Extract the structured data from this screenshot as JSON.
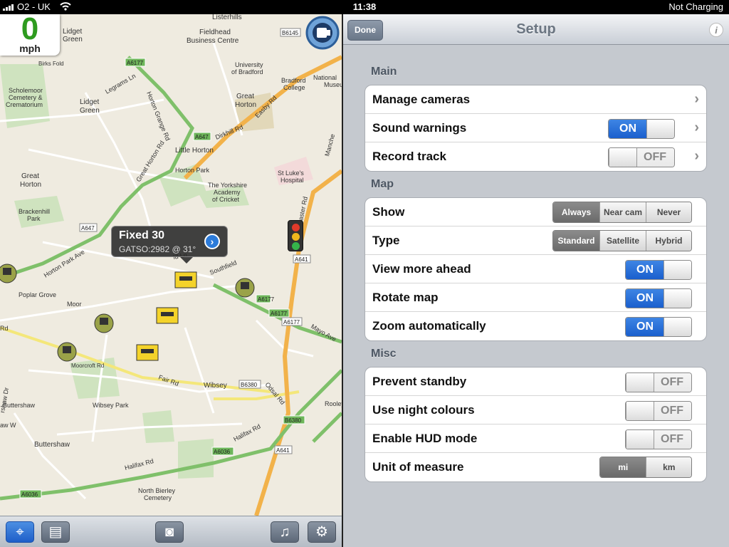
{
  "status_bar": {
    "carrier": "O2 - UK",
    "time": "11:38",
    "battery": "Not Charging"
  },
  "speed": {
    "value": "0",
    "unit": "mph"
  },
  "callout": {
    "title": "Fixed 30",
    "subtitle": "GATSO:2982 @ 31°"
  },
  "map_labels": {
    "lidget_green_1": "Lidget",
    "lidget_green_2": "Green",
    "fieldhead": "Fieldhead",
    "business_centre": "Business Centre",
    "listerhills": "Listerhills",
    "uni1": "University",
    "uni2": "of Bradford",
    "bradford_college1": "Bradford",
    "bradford_college2": "College",
    "national": "National",
    "museum": "Museu",
    "scholemoor1": "Scholemoor",
    "scholemoor2": "Cemetery &",
    "scholemoor3": "Crematorium",
    "lidget2_1": "Lidget",
    "lidget2_2": "Green",
    "great_horton1": "Great",
    "great_horton2": "Horton",
    "great_horton_b1": "Great",
    "great_horton_b2": "Horton",
    "little_horton": "Little Horton",
    "horton_park": "Horton Park",
    "yorkshire1": "The Yorkshire",
    "yorkshire2": "Academy",
    "yorkshire3": "of Cricket",
    "st_lukes1": "St Luke's",
    "st_lukes2": "Hospital",
    "brackenhill1": "Brackenhill",
    "brackenhill2": "Park",
    "poplar_grove": "Poplar Grove",
    "wibsey": "Wibsey",
    "wibsey_park": "Wibsey Park",
    "buttershaw": "Buttershaw",
    "buttershaw2": "Buttershaw",
    "north_bierley1": "North Bierley",
    "north_bierley2": "Cemetery",
    "horton_grange_rd": "Horton Grange Rd",
    "great_horton_rd": "Great Horton Rd",
    "horton_park_ave": "Horton Park Ave",
    "easby_rd": "Easby Rd",
    "dirkhill_rd": "Dirkhill Rd",
    "legrams_ln": "Legrams Ln",
    "southfield": "Southfield",
    "mayo_ave": "Mayo Ave",
    "fair_rd": "Fair Rd",
    "odsal_rd": "Odsal Rd",
    "halifax_rd": "Halifax Rd",
    "halifax_rd2": "Halifax Rd",
    "rooley": "Rooley",
    "moor": "Moor",
    "birks_fold": "Birks Fold",
    "mancross": "Manche",
    "a6177": "A6177",
    "a647": "A647",
    "a647b": "A647",
    "a641": "A641",
    "a641b": "A641",
    "a6177b": "A6177",
    "a6177c": "A6177",
    "b6145": "B6145",
    "b6380": "B6380",
    "b6380b": "B6380",
    "a6036": "A6036",
    "a6036b": "A6036",
    "a641c": "A641",
    "a6177d": "A6177",
    "aster_rd": "aster Rd",
    "fold1": "Birks Fold",
    "moorcroft": "Moorcroft Rd",
    "ldd_ln": "ld Ln",
    "road_rd": "Rd",
    "shaw_dr": "rshaw Dr",
    "aw_w": "aw W"
  },
  "toolbar": {
    "locate_icon": "crosshair-icon",
    "list_icon": "list-icon",
    "camera_icon": "camera-icon",
    "music_icon": "music-icon",
    "settings_icon": "gear-icon"
  },
  "nav": {
    "done": "Done",
    "title": "Setup",
    "info": "i"
  },
  "sections": {
    "main": {
      "header": "Main",
      "rows": [
        {
          "label": "Manage cameras"
        },
        {
          "label": "Sound warnings",
          "value": "ON"
        },
        {
          "label": "Record track",
          "value": "OFF"
        }
      ]
    },
    "map": {
      "header": "Map",
      "show": {
        "label": "Show",
        "options": [
          "Always",
          "Near cam",
          "Never"
        ],
        "selected": "Always"
      },
      "type": {
        "label": "Type",
        "options": [
          "Standard",
          "Satellite",
          "Hybrid"
        ],
        "selected": "Standard"
      },
      "toggles": [
        {
          "label": "View more ahead",
          "value": "ON"
        },
        {
          "label": "Rotate map",
          "value": "ON"
        },
        {
          "label": "Zoom automatically",
          "value": "ON"
        }
      ]
    },
    "misc": {
      "header": "Misc",
      "toggles": [
        {
          "label": "Prevent standby",
          "value": "OFF"
        },
        {
          "label": "Use night colours",
          "value": "OFF"
        },
        {
          "label": "Enable HUD mode",
          "value": "OFF"
        }
      ],
      "unit": {
        "label": "Unit of measure",
        "options": [
          "mi",
          "km"
        ],
        "selected": "mi"
      }
    }
  }
}
